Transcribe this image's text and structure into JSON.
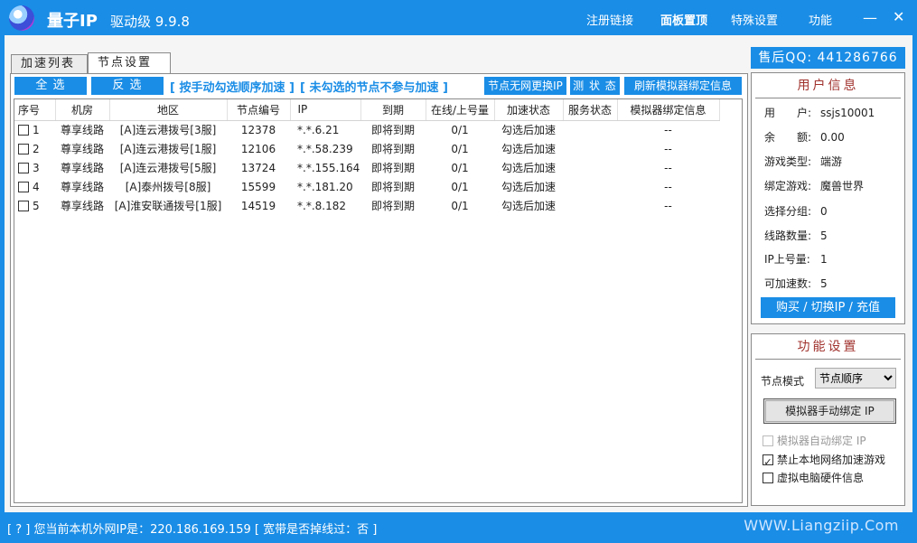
{
  "title": {
    "app_name": "量子IP",
    "version": "驱动级 9.9.8"
  },
  "topnav": [
    "注册链接",
    "面板置顶",
    "特殊设置",
    "功能"
  ],
  "window_buttons": {
    "minimize": "—",
    "close": "✕"
  },
  "tabs": [
    "加速列表",
    "节点设置"
  ],
  "toolbar": {
    "select_all": "全 选",
    "invert": "反 选",
    "hint1": "[ 按手动勾选顺序加速 ]",
    "hint2": "[ 未勾选的节点不参与加速 ]",
    "btn_no_net": "节点无网更换IP",
    "btn_test": "测 状 态",
    "btn_refresh": "刷新模拟器绑定信息"
  },
  "table": {
    "headers": [
      "序号",
      "机房",
      "地区",
      "节点编号",
      "IP",
      "到期",
      "在线/上号量",
      "加速状态",
      "服务状态",
      "模拟器绑定信息"
    ],
    "rows": [
      {
        "no": "1",
        "room": "尊享线路",
        "region": "[A]连云港拨号[3服]",
        "node": "12378",
        "ip": "*.*.6.21",
        "expire": "即将到期",
        "online": "0/1",
        "status": "勾选后加速",
        "service": "",
        "bind": "--"
      },
      {
        "no": "2",
        "room": "尊享线路",
        "region": "[A]连云港拨号[1服]",
        "node": "12106",
        "ip": "*.*.58.239",
        "expire": "即将到期",
        "online": "0/1",
        "status": "勾选后加速",
        "service": "",
        "bind": "--"
      },
      {
        "no": "3",
        "room": "尊享线路",
        "region": "[A]连云港拨号[5服]",
        "node": "13724",
        "ip": "*.*.155.164",
        "expire": "即将到期",
        "online": "0/1",
        "status": "勾选后加速",
        "service": "",
        "bind": "--"
      },
      {
        "no": "4",
        "room": "尊享线路",
        "region": "[A]泰州拨号[8服]",
        "node": "15599",
        "ip": "*.*.181.20",
        "expire": "即将到期",
        "online": "0/1",
        "status": "勾选后加速",
        "service": "",
        "bind": "--"
      },
      {
        "no": "5",
        "room": "尊享线路",
        "region": "[A]淮安联通拨号[1服]",
        "node": "14519",
        "ip": "*.*.8.182",
        "expire": "即将到期",
        "online": "0/1",
        "status": "勾选后加速",
        "service": "",
        "bind": "--"
      }
    ]
  },
  "qq": "售后QQ: 441286766",
  "user_info": {
    "title": "用户信息",
    "rows": [
      {
        "k": "用　　户:",
        "v": "ssjs10001"
      },
      {
        "k": "余　　额:",
        "v": "0.00"
      },
      {
        "k": "游戏类型:",
        "v": "端游"
      },
      {
        "k": "绑定游戏:",
        "v": "魔兽世界"
      },
      {
        "k": "选择分组:",
        "v": "0"
      },
      {
        "k": "线路数量:",
        "v": "5"
      },
      {
        "k": "IP上号量:",
        "v": "1"
      },
      {
        "k": "可加速数:",
        "v": "5"
      }
    ],
    "buy_button": "购买 / 切换IP / 充值"
  },
  "func_settings": {
    "title": "功能设置",
    "mode_label": "节点模式",
    "mode_value": "节点顺序",
    "bind_button": "模拟器手动绑定 IP",
    "checks": [
      {
        "label": "模拟器自动绑定 IP",
        "checked": false,
        "disabled": true
      },
      {
        "label": "禁止本地网络加速游戏",
        "checked": true,
        "disabled": false
      },
      {
        "label": "虚拟电脑硬件信息",
        "checked": false,
        "disabled": false
      }
    ]
  },
  "status": {
    "text": "[ ? ]  您当前本机外网IP是：220.186.169.159 [ 宽带是否掉线过：否 ]",
    "site": "WWW.Liangziip.Com"
  },
  "colors": {
    "accent": "#1a8de6",
    "title_red": "#a0322d"
  }
}
